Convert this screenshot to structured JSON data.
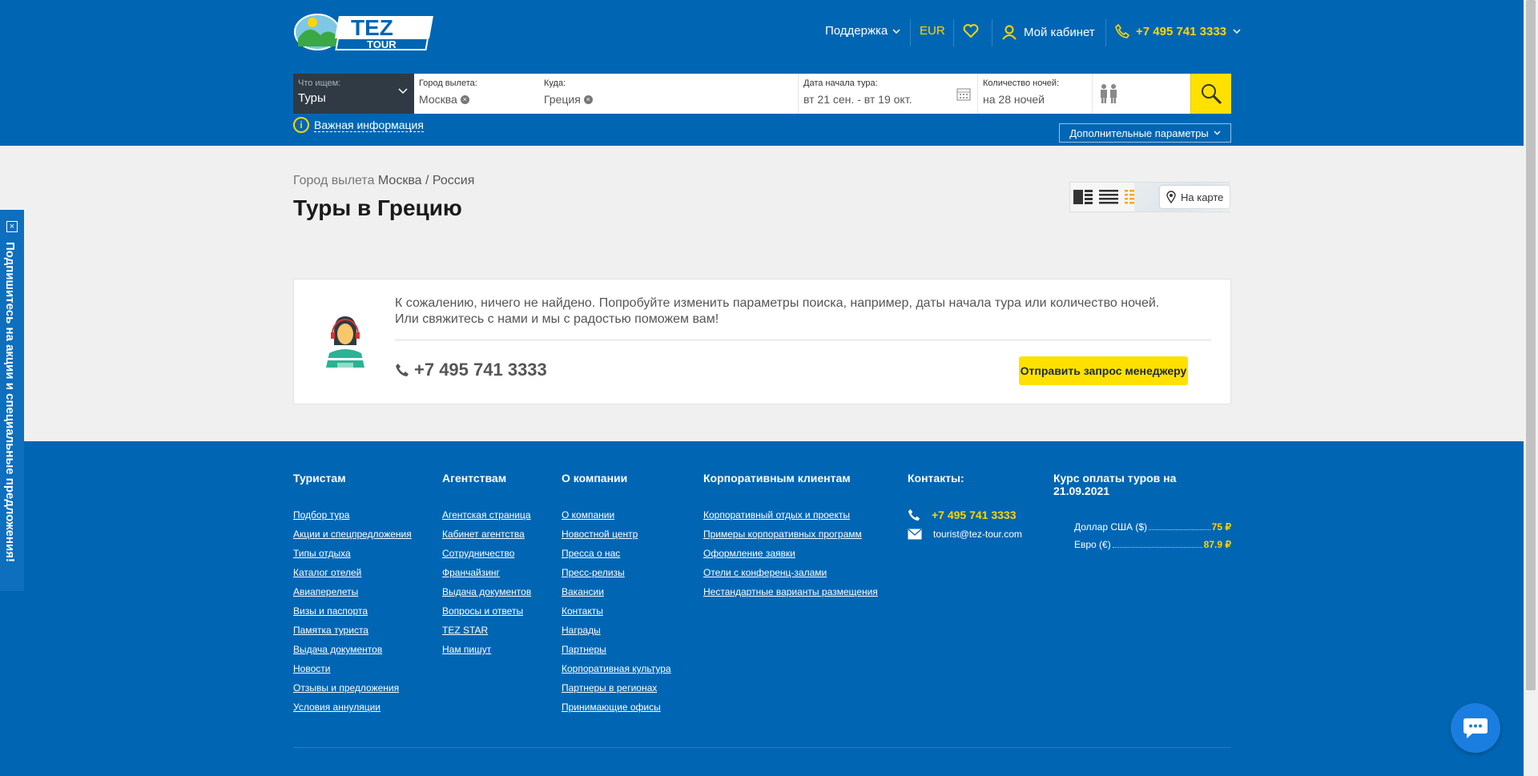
{
  "header": {
    "logo_text": "TEZ TOUR",
    "nav": {
      "support": "Поддержка",
      "currency": "EUR",
      "cabinet": "Мой кабинет",
      "phone": "+7 495 741 3333"
    }
  },
  "search": {
    "what": {
      "label": "Что ищем:",
      "value": "Туры"
    },
    "from": {
      "label": "Город вылета:",
      "value": "Москва"
    },
    "to": {
      "label": "Куда:",
      "value": "Греция"
    },
    "dates": {
      "label": "Дата начала тура:",
      "value": "вт 21 сен. - вт 19 окт."
    },
    "nights": {
      "label": "Количество ночей:",
      "value": "на 28 ночей"
    }
  },
  "important_info": "Важная информация",
  "extra_params": "Дополнительные параметры",
  "breadcrumb": {
    "prefix": "Город вылета",
    "city": "Москва / Россия"
  },
  "page_title": "Туры в Грецию",
  "map_button": "На карте",
  "empty": {
    "line1": "К сожалению, ничего не найдено. Попробуйте изменить параметры поиска, например, даты начала тура или количество ночей.",
    "line2": "Или свяжитесь с нами и мы с радостью поможем вам!",
    "phone": "+7 495 741 3333",
    "request_button": "Отправить запрос менеджеру"
  },
  "footer": {
    "tourists": {
      "title": "Туристам",
      "links": [
        "Подбор тура",
        "Акции и спецпредложения",
        "Типы отдыха",
        "Каталог отелей",
        "Авиаперелеты",
        "Визы и паспорта",
        "Памятка туриста",
        "Выдача документов",
        "Новости",
        "Отзывы и предложения",
        "Условия аннуляции"
      ]
    },
    "agencies": {
      "title": "Агентствам",
      "links": [
        "Агентская страница",
        "Кабинет агентства",
        "Сотрудничество",
        "Франчайзинг",
        "Выдача документов",
        "Вопросы и ответы",
        "TEZ STAR",
        "Нам пишут"
      ]
    },
    "company": {
      "title": "О компании",
      "links": [
        "О компании",
        "Новостной центр",
        "Пресса о нас",
        "Пресс-релизы",
        "Вакансии",
        "Контакты",
        "Награды",
        "Партнеры",
        "Корпоративная культура",
        "Партнеры в регионах",
        "Принимающие офисы"
      ]
    },
    "corporate": {
      "title": "Корпоративным клиентам",
      "links": [
        "Корпоративный отдых и проекты",
        "Примеры корпоративных программ",
        "Оформление заявки",
        "Отели с конференц-залами",
        "Нестандартные варианты размещения"
      ]
    },
    "contacts": {
      "title": "Контакты:",
      "phone": "+7 495 741 3333",
      "email": "tourist@tez-tour.com"
    },
    "rates": {
      "title": "Курс оплаты туров на 21.09.2021",
      "rows": [
        {
          "name": "Доллар США ($)",
          "value": "75 ₽"
        },
        {
          "name": "Евро (€)",
          "value": "87.9 ₽"
        }
      ]
    }
  },
  "side_tab": "Подпишитесь на акции и специальные предложения!",
  "colors": {
    "brand_blue": "#0066b3",
    "accent_yellow": "#ffe100",
    "dark_panel": "#2f3a45"
  }
}
